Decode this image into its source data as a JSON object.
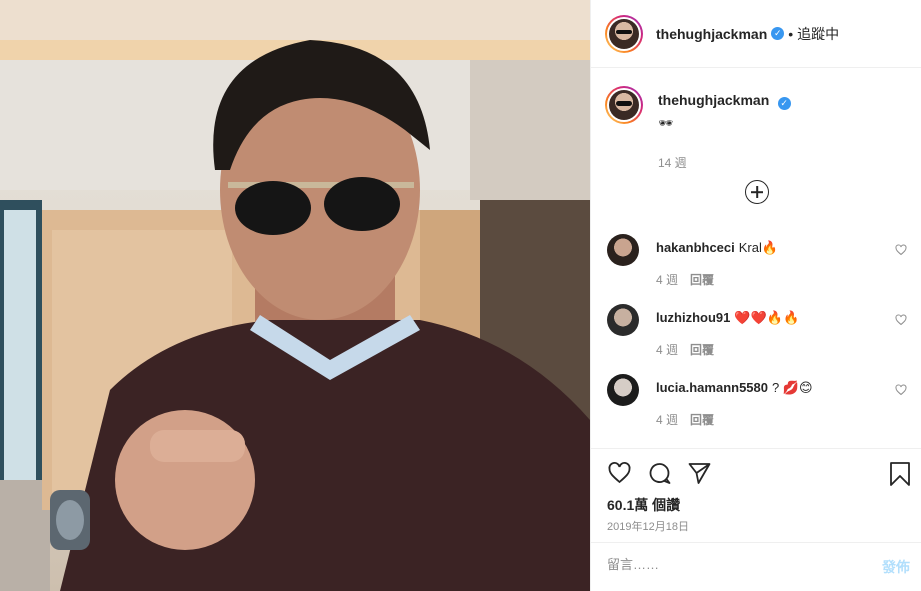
{
  "post": {
    "author": "thehughjackman",
    "follow_status": "追蹤中",
    "caption": "🕶",
    "caption_time": "14 週",
    "likes": "60.1萬 個讚",
    "date": "2019年12月18日"
  },
  "comments": [
    {
      "user": "hakanbhceci",
      "text": "Kral🔥",
      "time": "4 週",
      "reply": "回覆"
    },
    {
      "user": "luzhizhou91",
      "text": "❤️❤️🔥🔥",
      "time": "4 週",
      "reply": "回覆"
    },
    {
      "user": "lucia.hamann5580",
      "text": "? 💋😊",
      "time": "4 週",
      "reply": "回覆"
    }
  ],
  "composer": {
    "placeholder": "留言……",
    "post_label": "發佈"
  },
  "icons": {
    "verified": "verified-badge-icon",
    "like": "heart-icon",
    "comment": "comment-bubble-icon",
    "share": "paper-plane-icon",
    "save": "bookmark-icon",
    "load_more": "plus-circle-icon"
  },
  "colors": {
    "accent": "#3897f0",
    "muted": "#8e8e8e",
    "post_disabled": "#b2dffc"
  }
}
